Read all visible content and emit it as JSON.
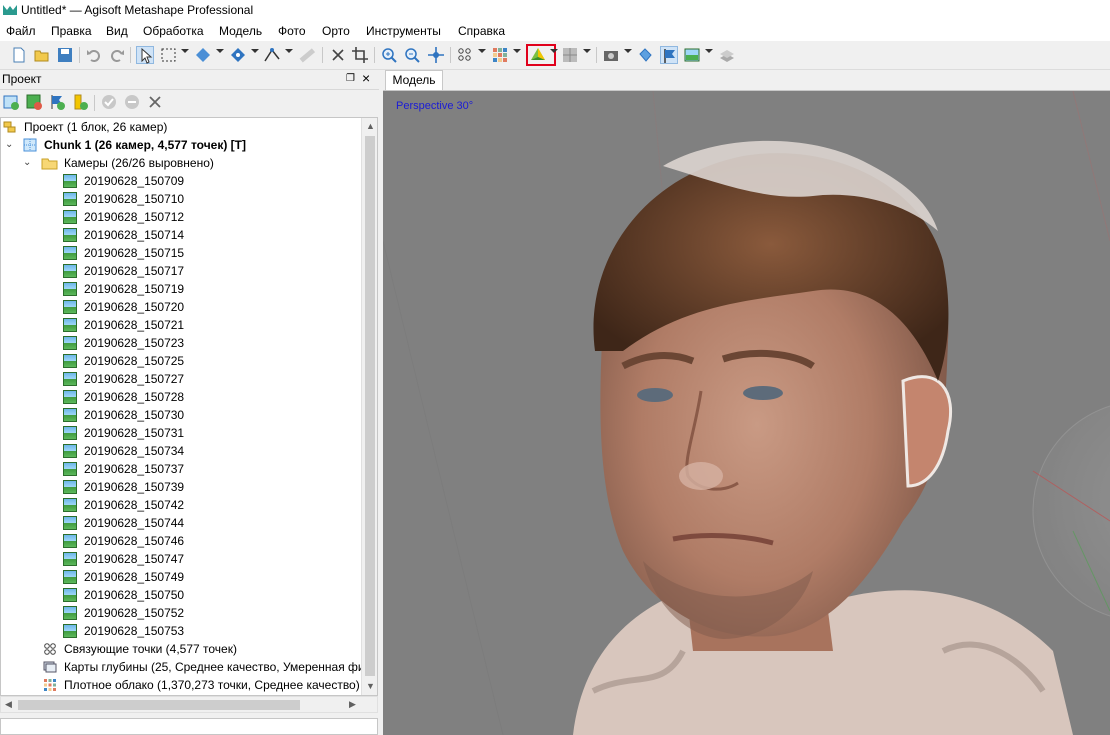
{
  "window": {
    "title": "Untitled* — Agisoft Metashape Professional"
  },
  "menu": [
    "Файл",
    "Правка",
    "Вид",
    "Обработка",
    "Модель",
    "Фото",
    "Орто",
    "Инструменты",
    "Справка"
  ],
  "toolbar": {
    "icons": [
      "new-icon",
      "open-icon",
      "save-icon",
      "undo-icon",
      "redo-icon",
      "navigation-icon",
      "rectangle-selection-icon",
      "resize-region-icon",
      "rotate-object-icon",
      "draw-polyline-icon",
      "ruler-icon",
      "delete-icon",
      "crop-icon",
      "zoom-in-icon",
      "zoom-out-icon",
      "reset-view-icon",
      "point-cloud-icon",
      "dense-cloud-icon",
      "model-shaded-icon",
      "tiled-model-icon",
      "show-cameras-icon",
      "show-markers-icon",
      "show-shapes-icon",
      "show-images-icon",
      "show-region-icon"
    ],
    "highlighted": "model-shaded-icon",
    "highlight_color": "#e0001b"
  },
  "project_panel": {
    "title": "Проект",
    "root": "Проект (1 блок, 26 камер)",
    "chunk": "Chunk 1 (26 камер, 4,577 точек) [T]",
    "cameras_folder": "Камеры (26/26 выровнено)",
    "cameras": [
      "20190628_150709",
      "20190628_150710",
      "20190628_150712",
      "20190628_150714",
      "20190628_150715",
      "20190628_150717",
      "20190628_150719",
      "20190628_150720",
      "20190628_150721",
      "20190628_150723",
      "20190628_150725",
      "20190628_150727",
      "20190628_150728",
      "20190628_150730",
      "20190628_150731",
      "20190628_150734",
      "20190628_150737",
      "20190628_150739",
      "20190628_150742",
      "20190628_150744",
      "20190628_150746",
      "20190628_150747",
      "20190628_150749",
      "20190628_150750",
      "20190628_150752",
      "20190628_150753"
    ],
    "tie_points": "Связующие точки (4,577 точек)",
    "depth_maps": "Карты глубины (25, Среднее качество, Умеренная фи.",
    "dense_cloud": "Плотное облако (1,370,273 точки, Среднее качество)"
  },
  "model_view": {
    "tab": "Модель",
    "projection_label": "Perspective 30°",
    "background_color": "#808080"
  }
}
